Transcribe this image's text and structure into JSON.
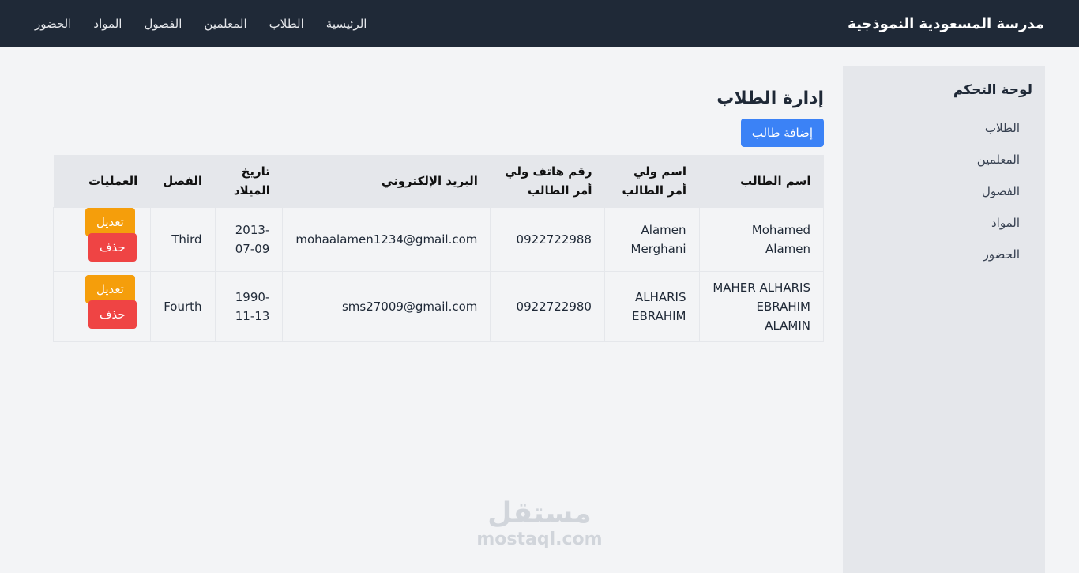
{
  "navbar": {
    "brand": "مدرسة المسعودية النموذجية",
    "links": [
      "الرئيسية",
      "الطلاب",
      "المعلمين",
      "الفصول",
      "المواد",
      "الحضور"
    ]
  },
  "sidebar": {
    "title": "لوحة التحكم",
    "items": [
      "الطلاب",
      "المعلمين",
      "الفصول",
      "المواد",
      "الحضور"
    ]
  },
  "main": {
    "title": "إدارة الطلاب",
    "add_label": "إضافة طالب"
  },
  "table": {
    "headers": [
      "اسم الطالب",
      "اسم ولي أمر الطالب",
      "رقم هاتف ولي أمر الطالب",
      "البريد الإلكتروني",
      "تاريخ الميلاد",
      "الفصل",
      "العمليات"
    ],
    "rows": [
      [
        "Mohamed Alamen",
        "Alamen Merghani",
        "0922722988",
        "mohaalamen1234@gmail.com",
        "2013-07-09",
        "Third"
      ],
      [
        "MAHER ALHARIS EBRAHIM ALAMIN",
        "ALHARIS EBRAHIM",
        "0922722980",
        "sms27009@gmail.com",
        "1990-11-13",
        "Fourth"
      ]
    ],
    "edit_label": "تعديل",
    "delete_label": "حذف"
  },
  "watermark": {
    "arabic": "مستقل",
    "latin": "mostaql.com"
  },
  "colors": {
    "navbar": "#1f2937",
    "primary": "#3b82f6",
    "warning": "#f59e0b",
    "danger": "#ef4444"
  }
}
